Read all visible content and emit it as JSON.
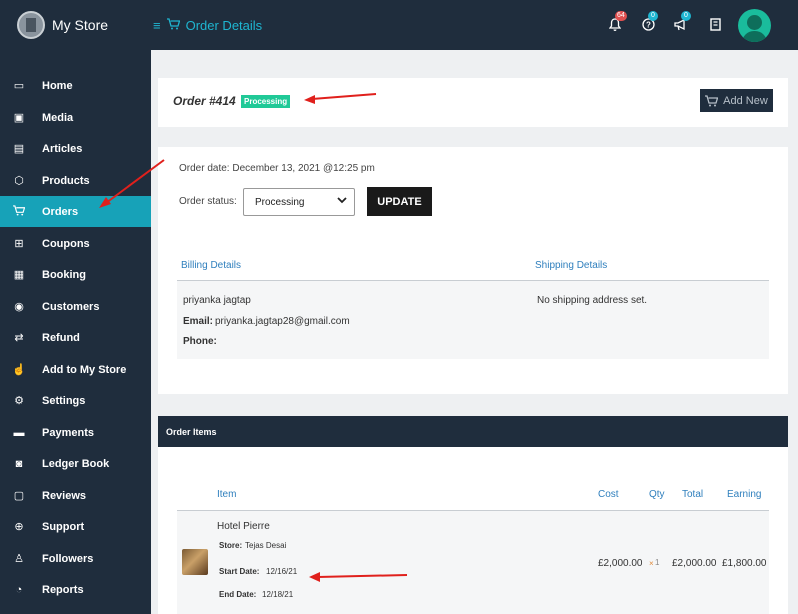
{
  "brand": {
    "name": "My Store"
  },
  "header": {
    "title": "Order Details"
  },
  "notifications": {
    "bell_count": "64",
    "help_count": "0",
    "announce_count": "0"
  },
  "sidebar": {
    "items": [
      {
        "label": "Home",
        "icon": "monitor-icon"
      },
      {
        "label": "Media",
        "icon": "image-icon"
      },
      {
        "label": "Articles",
        "icon": "document-icon"
      },
      {
        "label": "Products",
        "icon": "box-icon"
      },
      {
        "label": "Orders",
        "icon": "cart-icon",
        "active": true
      },
      {
        "label": "Coupons",
        "icon": "gift-icon"
      },
      {
        "label": "Booking",
        "icon": "calendar-icon"
      },
      {
        "label": "Customers",
        "icon": "user-circle-icon"
      },
      {
        "label": "Refund",
        "icon": "retweet-icon"
      },
      {
        "label": "Add to My Store",
        "icon": "hand-pointer-icon"
      },
      {
        "label": "Settings",
        "icon": "cogs-icon"
      },
      {
        "label": "Payments",
        "icon": "credit-card-icon"
      },
      {
        "label": "Ledger Book",
        "icon": "money-icon"
      },
      {
        "label": "Reviews",
        "icon": "comment-icon"
      },
      {
        "label": "Support",
        "icon": "lifebuoy-icon"
      },
      {
        "label": "Followers",
        "icon": "male-icon"
      },
      {
        "label": "Reports",
        "icon": "pie-chart-icon"
      }
    ]
  },
  "order": {
    "title": "Order #414",
    "status_badge": "Processing",
    "add_new_label": "Add New",
    "date_text": "Order date: December 13, 2021 @12:25 pm",
    "status_label": "Order status:",
    "status_value": "Processing",
    "update_label": "UPDATE"
  },
  "billing": {
    "heading": "Billing Details",
    "name": "priyanka jagtap",
    "email_label": "Email:",
    "email": "priyanka.jagtap28@gmail.com",
    "phone_label": "Phone:"
  },
  "shipping": {
    "heading": "Shipping Details",
    "text": "No shipping address set."
  },
  "items": {
    "section_title": "Order Items",
    "columns": {
      "item": "Item",
      "cost": "Cost",
      "qty": "Qty",
      "total": "Total",
      "earning": "Earning"
    },
    "rows": [
      {
        "name": "Hotel Pierre",
        "store_label": "Store:",
        "store": "Tejas Desai",
        "start_label": "Start Date:",
        "start": "12/16/21",
        "end_label": "End Date:",
        "end": "12/18/21",
        "cost": "£2,000.00",
        "qty_mark": "×",
        "qty": "1",
        "total": "£2,000.00",
        "earning": "£1,800.00"
      }
    ]
  },
  "colors": {
    "sidebar_bg": "#1f2d3d",
    "accent": "#17a2b8",
    "status_green": "#20c997",
    "annotation_red": "#e0201c"
  }
}
